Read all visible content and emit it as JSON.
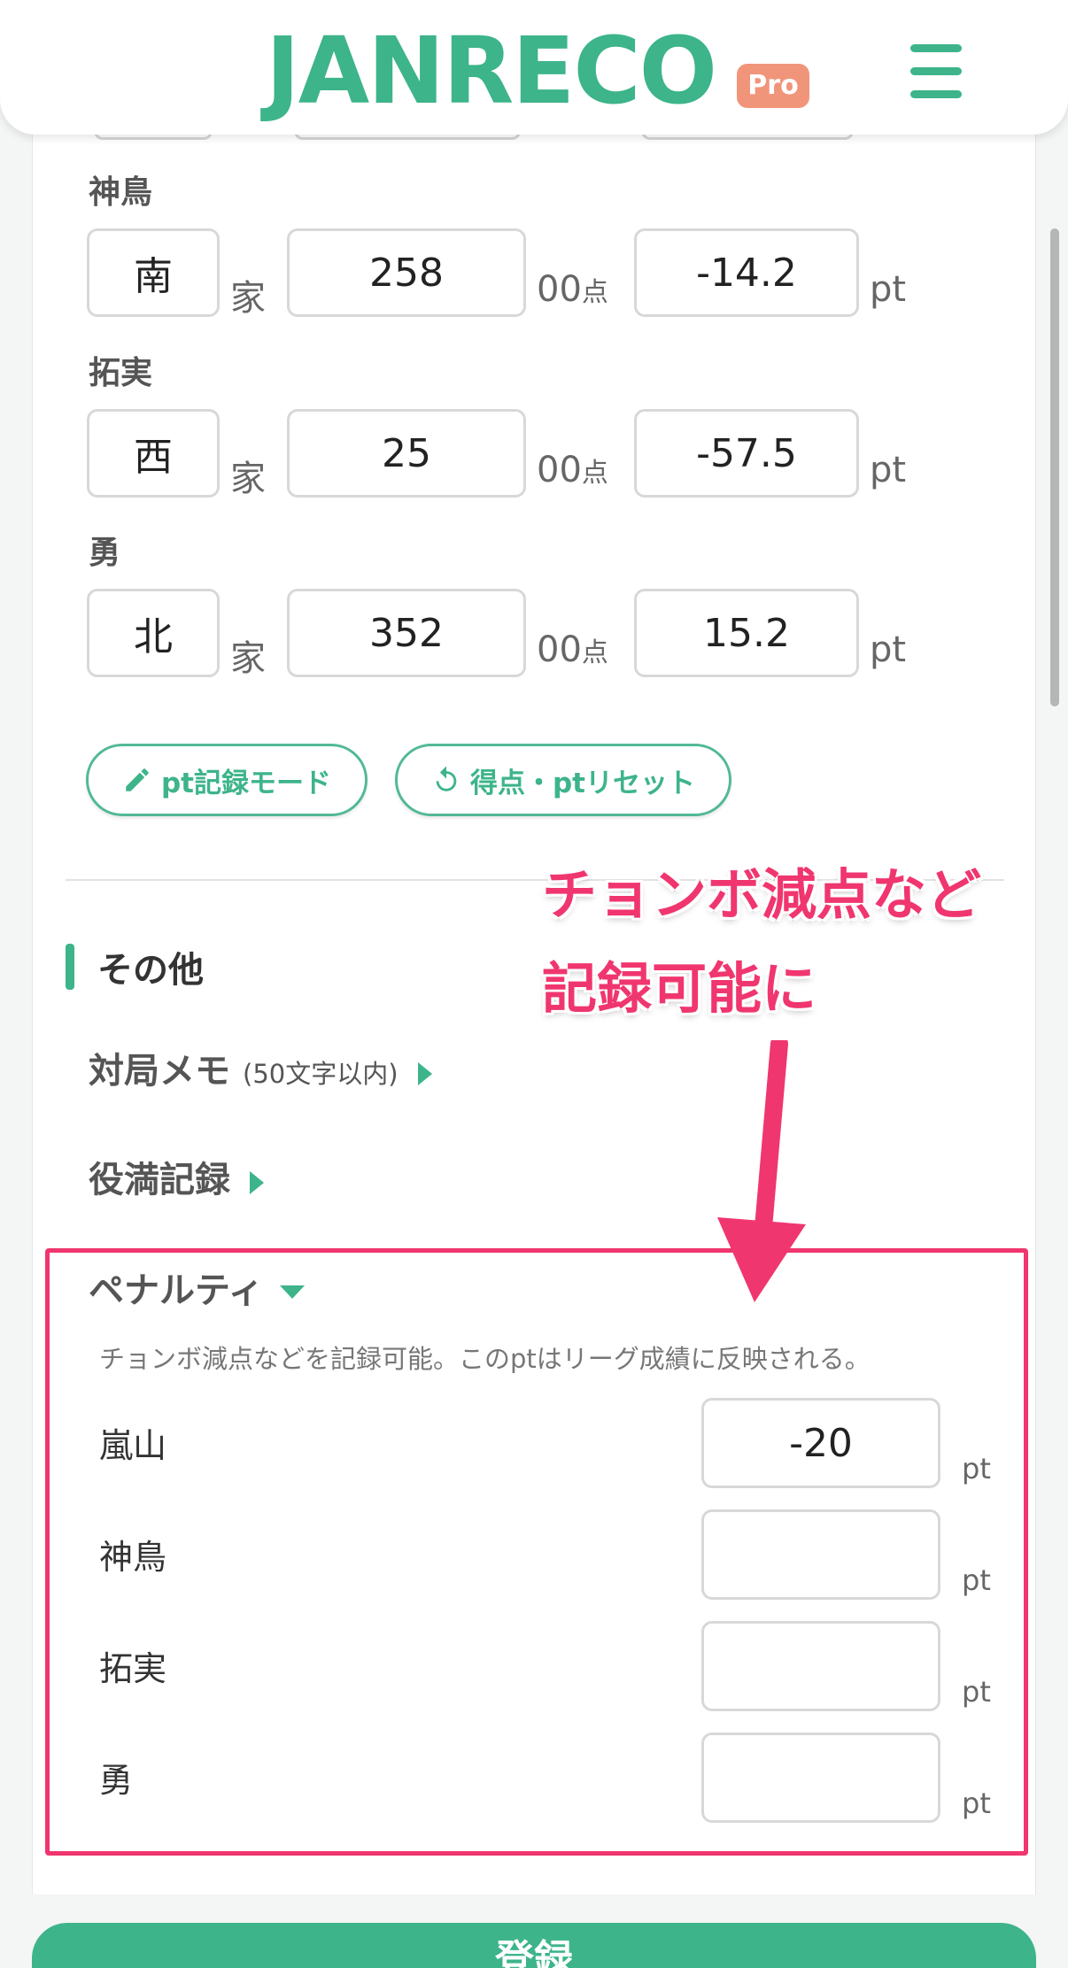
{
  "header": {
    "logo": "JANRECO",
    "badge": "Pro"
  },
  "players": [
    {
      "name": "神鳥",
      "wind": "南",
      "wind_unit": "家",
      "score": "258",
      "score_suffix": "00",
      "score_unit": "点",
      "pt": "-14.2",
      "pt_unit": "pt"
    },
    {
      "name": "拓実",
      "wind": "西",
      "wind_unit": "家",
      "score": "25",
      "score_suffix": "00",
      "score_unit": "点",
      "pt": "-57.5",
      "pt_unit": "pt"
    },
    {
      "name": "勇",
      "wind": "北",
      "wind_unit": "家",
      "score": "352",
      "score_suffix": "00",
      "score_unit": "点",
      "pt": "15.2",
      "pt_unit": "pt"
    }
  ],
  "buttons": {
    "pt_mode": "pt記録モード",
    "reset": "得点・ptリセット",
    "save": "登録"
  },
  "other_section": {
    "title": "その他",
    "memo_label": "対局メモ",
    "memo_sub": "(50文字以内)",
    "yakuman_label": "役満記録",
    "penalty_label": "ペナルティ",
    "penalty_desc": "チョンボ減点などを記録可能。このptはリーグ成績に反映される。",
    "penalties": [
      {
        "name": "嵐山",
        "value": "-20",
        "unit": "pt"
      },
      {
        "name": "神鳥",
        "value": "",
        "unit": "pt"
      },
      {
        "name": "拓実",
        "value": "",
        "unit": "pt"
      },
      {
        "name": "勇",
        "value": "",
        "unit": "pt"
      }
    ]
  },
  "annotation": {
    "line1": "チョンボ減点など",
    "line2": "記録可能に",
    "color": "#f0366f"
  },
  "colors": {
    "accent": "#3db48a",
    "highlight": "#f0366f",
    "badge": "#f1957a"
  }
}
